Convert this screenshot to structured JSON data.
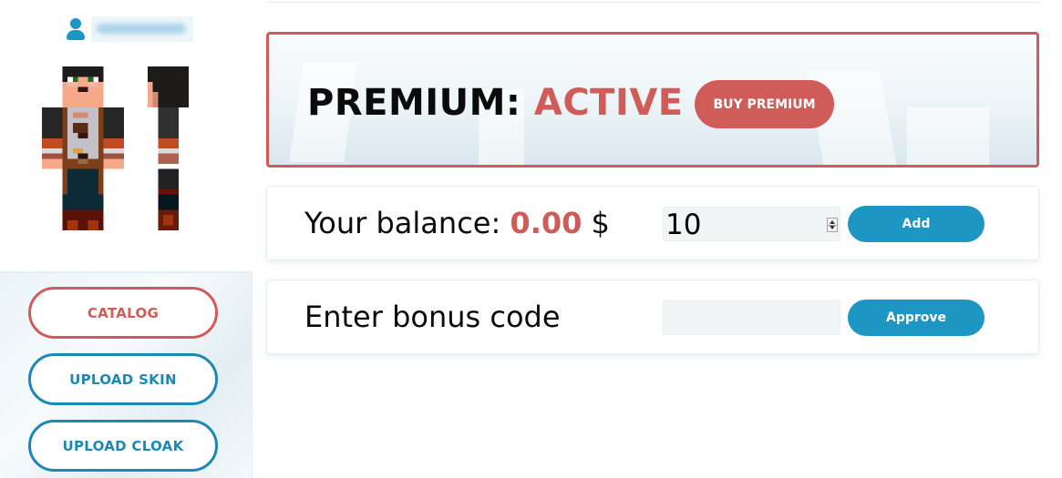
{
  "user": {
    "icon": "user-icon",
    "username": "username (blurred)"
  },
  "sidebar": {
    "buttons": [
      {
        "label": "CATALOG",
        "color": "#d05c5a"
      },
      {
        "label": "UPLOAD SKIN",
        "color": "#1e88b4"
      },
      {
        "label": "UPLOAD CLOAK",
        "color": "#1e88b4"
      }
    ]
  },
  "premium": {
    "label": "PREMIUM:",
    "status": "ACTIVE",
    "buy_button": "BUY PREMIUM",
    "accent_color": "#d05c5a"
  },
  "balance": {
    "label": "Your balance:",
    "value": "0.00",
    "currency": "$",
    "input_value": "10",
    "button": "Add"
  },
  "bonus": {
    "label": "Enter bonus code",
    "input_value": "",
    "button": "Approve"
  },
  "colors": {
    "primary_blue": "#1e96c4",
    "accent_red": "#d05c5a"
  }
}
